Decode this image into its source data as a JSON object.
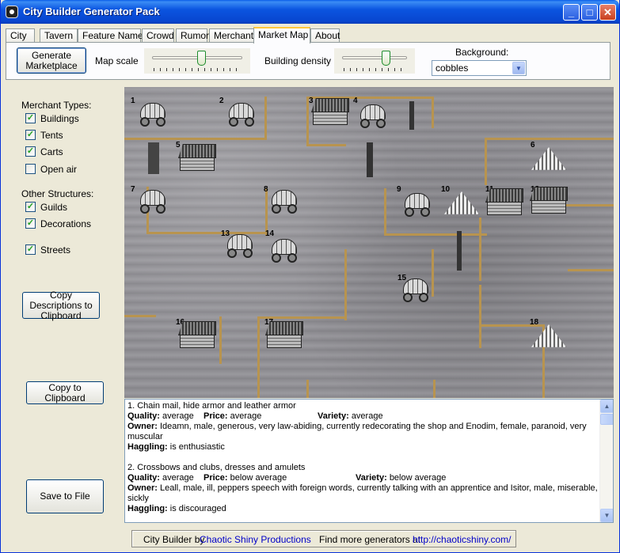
{
  "window": {
    "title": "City Builder Generator Pack",
    "controls": {
      "minimize": "minimize-icon",
      "maximize": "maximize-icon",
      "close": "close-icon"
    }
  },
  "tabs": [
    {
      "label": "City"
    },
    {
      "label": "Tavern"
    },
    {
      "label": "Feature Namer"
    },
    {
      "label": "Crowd"
    },
    {
      "label": "Rumor"
    },
    {
      "label": "Merchant"
    },
    {
      "label": "Market Map",
      "active": true
    },
    {
      "label": "About"
    }
  ],
  "toolbar": {
    "generate_label": "Generate Marketplace",
    "map_scale_label": "Map scale",
    "map_scale_value": 0.55,
    "density_label": "Building density",
    "density_value": 0.7,
    "background_label": "Background:",
    "background_value": "cobbles"
  },
  "sidebar": {
    "merchant_types_label": "Merchant Types:",
    "merchant_types": [
      {
        "label": "Buildings",
        "checked": true
      },
      {
        "label": "Tents",
        "checked": true
      },
      {
        "label": "Carts",
        "checked": true
      },
      {
        "label": "Open air",
        "checked": false
      }
    ],
    "other_structures_label": "Other Structures:",
    "other_structures": [
      {
        "label": "Guilds",
        "checked": true
      },
      {
        "label": "Decorations",
        "checked": true
      },
      {
        "label": "Streets",
        "checked": true
      }
    ],
    "copy_descriptions_label": "Copy Descriptions to Clipboard",
    "copy_clipboard_label": "Copy to Clipboard",
    "save_file_label": "Save to File"
  },
  "map": {
    "numbers": [
      "1",
      "2",
      "3",
      "4",
      "5",
      "6",
      "7",
      "8",
      "9",
      "10",
      "11",
      "12",
      "13",
      "14",
      "15",
      "16",
      "17",
      "18"
    ]
  },
  "descriptions": [
    {
      "heading": "1. Chain mail, hide armor and leather armor",
      "quality_label": "Quality:",
      "quality": "average",
      "price_label": "Price:",
      "price": "average",
      "variety_label": "Variety:",
      "variety": "average",
      "owner_label": "Owner:",
      "owner": "Ideamn, male, generous, very law-abiding, currently redecorating the shop and Enodim, female, paranoid, very muscular",
      "haggling_label": "Haggling:",
      "haggling": "is enthusiastic"
    },
    {
      "heading": "2. Crossbows and clubs, dresses and amulets",
      "quality_label": "Quality:",
      "quality": "average",
      "price_label": "Price:",
      "price": "below average",
      "variety_label": "Variety:",
      "variety": "below average",
      "owner_label": "Owner:",
      "owner": "Leall, male, ill, peppers speech with foreign words, currently talking with an apprentice and Isitor, male, miserable, sickly",
      "haggling_label": "Haggling:",
      "haggling": "is discouraged"
    }
  ],
  "status": {
    "prefix": "City Builder by",
    "company": "Chaotic Shiny Productions",
    "find_more": "Find more generators at",
    "url": "http://chaoticshiny.com/"
  }
}
